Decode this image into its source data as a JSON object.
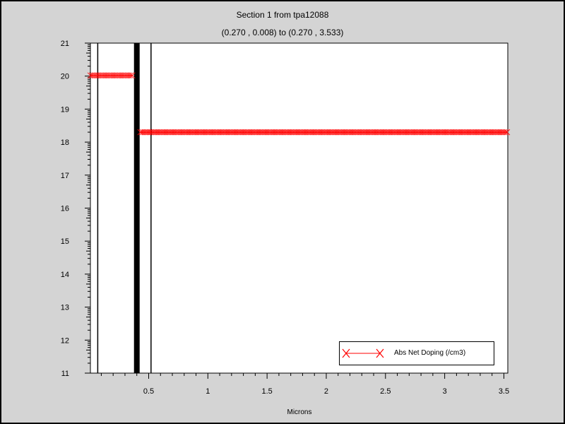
{
  "chart_data": {
    "type": "line",
    "title": "Section 1 from tpa12088",
    "subtitle": "(0.270 , 0.008) to (0.270 , 3.533)",
    "xlabel": "Microns",
    "ylabel": "",
    "xlim": [
      0.008,
      3.533
    ],
    "ylim": [
      11,
      21
    ],
    "yscale": "log10 (tick labels show exponent)",
    "x_ticks": [
      "0.5",
      "1",
      "1.5",
      "2",
      "2.5",
      "3",
      "3.5"
    ],
    "y_ticks": [
      "11",
      "12",
      "13",
      "14",
      "15",
      "16",
      "17",
      "18",
      "19",
      "20",
      "21"
    ],
    "grid": false,
    "legend_position": "bottom-right",
    "series": [
      {
        "name": "Abs Net Doping (/cm3)",
        "color": "#ff0000",
        "marker": "x",
        "segments": [
          {
            "x_start": 0.008,
            "x_end": 0.37,
            "y": 20.02
          },
          {
            "x_start": 0.43,
            "x_end": 3.533,
            "y": 18.3
          }
        ]
      }
    ],
    "region_boundaries_x": [
      0.07,
      0.4,
      0.52
    ],
    "thick_boundary_x": 0.4
  }
}
